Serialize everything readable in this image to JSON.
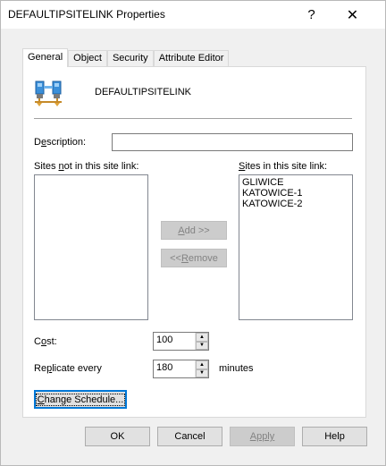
{
  "window": {
    "title": "DEFAULTIPSITELINK Properties",
    "help_glyph": "?",
    "close_glyph": "✕"
  },
  "tabs": [
    {
      "label": "General",
      "active": true
    },
    {
      "label": "Object",
      "active": false
    },
    {
      "label": "Security",
      "active": false
    },
    {
      "label": "Attribute Editor",
      "active": false
    }
  ],
  "general": {
    "object_name": "DEFAULTIPSITELINK",
    "object_icon": "site-link-icon",
    "description": {
      "label_pre": "D",
      "label_u": "e",
      "label_post": "scription:",
      "value": ""
    },
    "sites_not_in": {
      "label_pre": "Sites ",
      "label_u": "n",
      "label_post": "ot in this site link:",
      "items": []
    },
    "sites_in": {
      "label_pre": "",
      "label_u": "S",
      "label_post": "ites in this site link:",
      "items": [
        "GLIWICE",
        "KATOWICE-1",
        "KATOWICE-2"
      ]
    },
    "add_button": {
      "label_pre": "",
      "label_u": "A",
      "label_post": "dd >>",
      "disabled": true
    },
    "remove_button": {
      "label_pre": "<< ",
      "label_u": "R",
      "label_post": "emove",
      "disabled": true
    },
    "cost": {
      "label_pre": "C",
      "label_u": "o",
      "label_post": "st:",
      "value": "100"
    },
    "replicate": {
      "label_pre": "Re",
      "label_u": "p",
      "label_post": "licate every",
      "value": "180",
      "unit": "minutes"
    },
    "change_schedule": {
      "label_pre": "",
      "label_u": "C",
      "label_post": "hange Schedule..."
    }
  },
  "footer": {
    "ok": "OK",
    "cancel": "Cancel",
    "apply": "Apply",
    "help": "Help"
  }
}
